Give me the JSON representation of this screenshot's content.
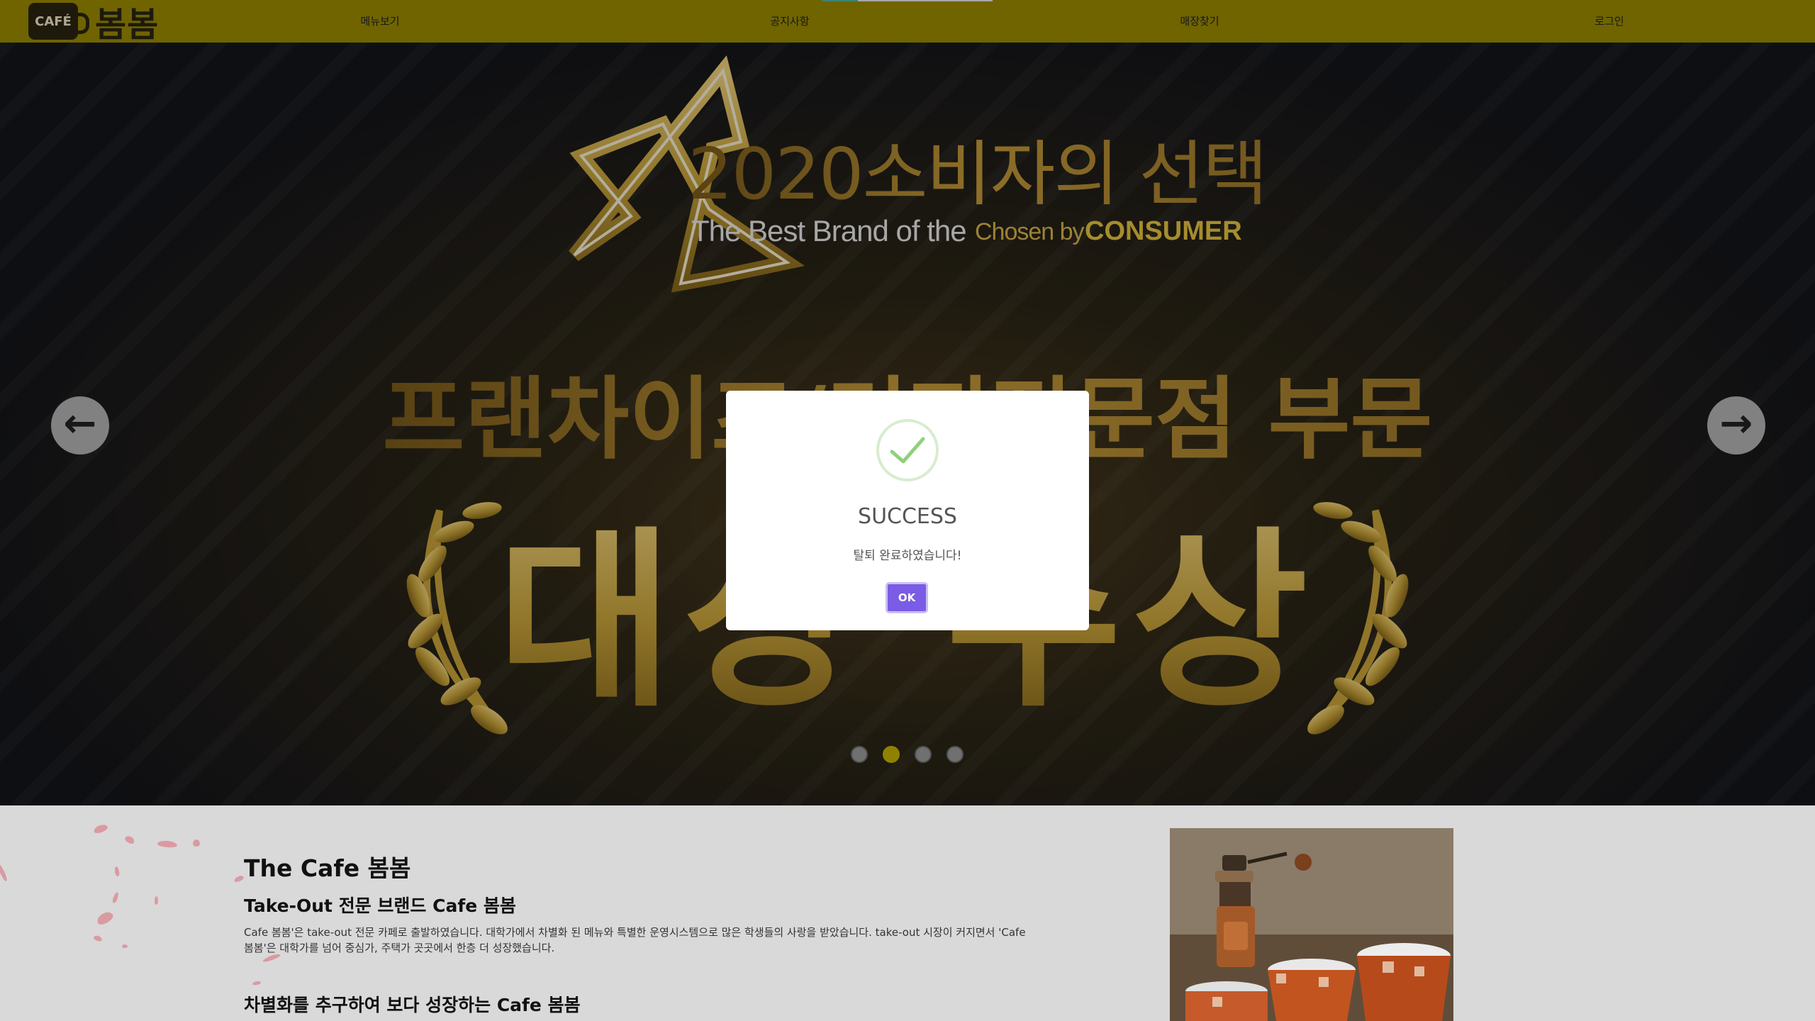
{
  "header": {
    "logo_badge": "CAFÉ",
    "logo_name": "봄봄",
    "nav": [
      {
        "label": "메뉴보기"
      },
      {
        "label": "공지사항"
      },
      {
        "label": "매장찾기"
      },
      {
        "label": "로그인"
      }
    ]
  },
  "banner": {
    "headline": "2020소비자의 선택",
    "tagline_part1": "The Best Brand of the",
    "tagline_part2": "Chosen by",
    "tagline_part3": "CONSUMER",
    "category": "프랜차이즈/커피전문점 부문",
    "award": "대상 수상",
    "prev_icon": "arrow-left",
    "next_icon": "arrow-right",
    "slide_count": 4,
    "active_slide": 2
  },
  "modal": {
    "icon": "checkmark",
    "title": "SUCCESS",
    "message": "탈퇴 완료하였습니다!",
    "ok_label": "OK"
  },
  "about": {
    "title": "The Cafe 봄봄",
    "subtitle": "Take-Out 전문 브랜드 Cafe 봄봄",
    "body": "Cafe 봄봄'은 take-out 전문 카페로 출발하였습니다. 대학가에서 차별화 된 메뉴와 특별한 운영시스템으로 많은 학생들의 사랑을 받았습니다. take-out 시장이 커지면서 'Cafe 봄봄'은 대학가를 넘어 중심가, 주택가 곳곳에서 한층 더 성장했습니다.",
    "subtitle2": "차별화를 추구하여 보다 성장하는 Cafe 봄봄"
  },
  "colors": {
    "header_bg": "#9a8b00",
    "active_dot": "#c8b400",
    "ok_button": "#7a5ce6",
    "gold": "#c9a43a"
  }
}
